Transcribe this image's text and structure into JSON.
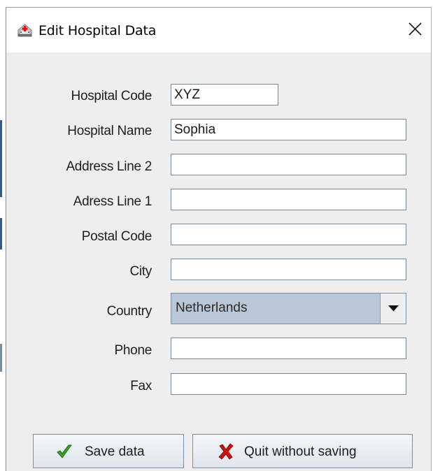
{
  "window": {
    "title": "Edit Hospital Data",
    "icon": "hospital-app-icon",
    "close_icon": "close-icon"
  },
  "form": {
    "hospital_code": {
      "label": "Hospital Code",
      "value": "XYZ"
    },
    "hospital_name": {
      "label": "Hospital Name",
      "value": "Sophia"
    },
    "address_line_2": {
      "label": "Address Line 2",
      "value": ""
    },
    "address_line_1": {
      "label": "Adress Line 1",
      "value": ""
    },
    "postal_code": {
      "label": "Postal Code",
      "value": ""
    },
    "city": {
      "label": "City",
      "value": ""
    },
    "country": {
      "label": "Country",
      "value": "Netherlands",
      "icon": "chevron-down-icon"
    },
    "phone": {
      "label": "Phone",
      "value": ""
    },
    "fax": {
      "label": "Fax",
      "value": ""
    }
  },
  "buttons": {
    "save": {
      "label": "Save data",
      "icon": "checkmark-icon",
      "icon_color": "#3aa52a"
    },
    "quit": {
      "label": "Quit without saving",
      "icon": "x-mark-icon",
      "icon_color": "#cc1111"
    }
  },
  "colors": {
    "window_bg": "#eeeeee",
    "combo_bg": "#b9c7d6",
    "field_border": "#7a8a99"
  }
}
